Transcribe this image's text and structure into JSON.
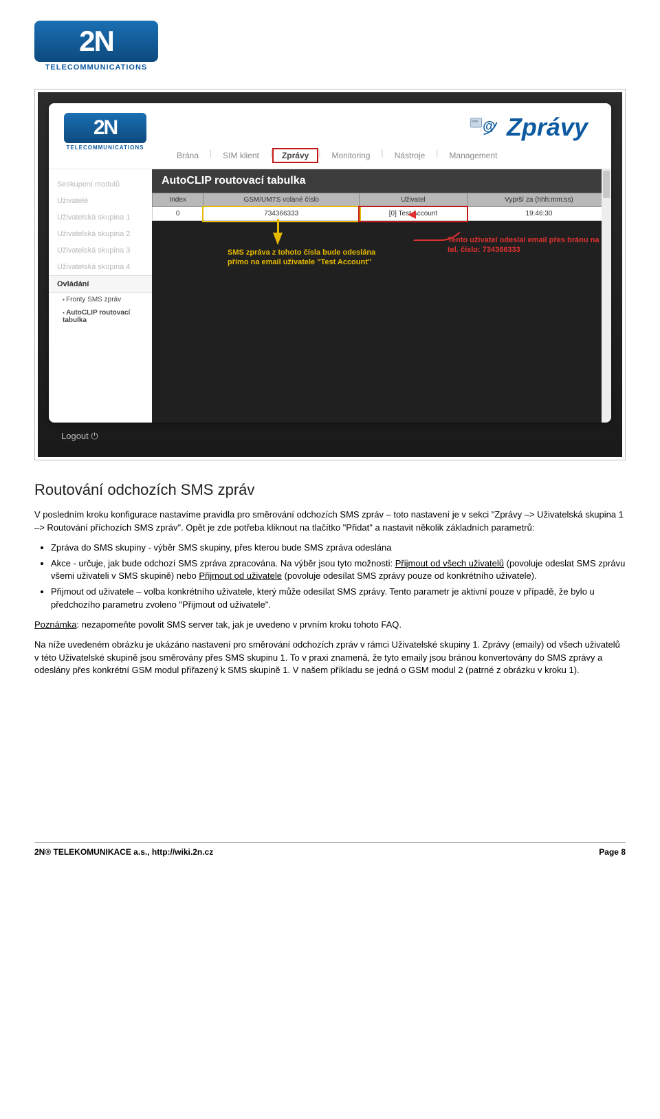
{
  "logo": {
    "text": "2N",
    "caption": "TELECOMMUNICATIONS"
  },
  "screenshot": {
    "header": {
      "title": "Zprávy",
      "nav": [
        "Brána",
        "SIM klient",
        "Zprávy",
        "Monitoring",
        "Nástroje",
        "Management"
      ],
      "active_index": 2
    },
    "sidebar": {
      "items": [
        "Seskupení modulů",
        "Uživatelé",
        "Uživatelská skupina 1",
        "Uživatelská skupina 2",
        "Uživatelská skupina 3",
        "Uživatelská skupina 4"
      ],
      "section": "Ovládání",
      "subitems": [
        "Fronty SMS zpráv",
        "AutoCLIP routovací tabulka"
      ]
    },
    "main": {
      "title": "AutoCLIP routovací tabulka",
      "table": {
        "headers": [
          "Index",
          "GSM/UMTS volané číslo",
          "Uživatel",
          "Vyprší za (hhh:mm:ss)"
        ],
        "row": [
          "0",
          "734366333",
          "[0] Test Account",
          "19:46:30"
        ]
      },
      "annot_yellow": "SMS zpráva z tohoto čísla bude odeslána přímo na email uživatele \"Test Account\"",
      "annot_red": "Tento uživatel odeslal email přes bránu na tel. číslo: 734366333"
    },
    "logout": "Logout"
  },
  "article": {
    "heading": "Routování odchozích SMS zpráv",
    "p1": "V posledním kroku konfigurace nastavíme pravidla pro směrování odchozích SMS zpráv – toto nastavení je v sekci \"Zprávy –> Uživatelská skupina 1 –> Routování příchozích SMS zpráv\". Opět je zde potřeba kliknout na tlačítko \"Přidat\" a nastavit několik základních parametrů:",
    "bullet1": "Zpráva do SMS skupiny - výběr SMS skupiny, přes kterou bude SMS zpráva odeslána",
    "bullet2a": "Akce - určuje, jak bude odchozí SMS zpráva zpracována. Na výběr jsou tyto možnosti: ",
    "bullet2_u1": "Přijmout od všech uživatelů",
    "bullet2b": " (povoluje odeslat SMS zprávu všemi uživateli v SMS skupině) nebo ",
    "bullet2_u2": "Přijmout od uživatele",
    "bullet2c": " (povoluje odesílat SMS zprávy pouze od konkrétního uživatele).",
    "bullet3": "Přijmout od uživatele – volba konkrétního uživatele, který může odesílat SMS zprávy. Tento parametr je aktivní pouze v případě, že bylo u předchozího parametru zvoleno \"Přijmout od uživatele\".",
    "p2_u": "Poznámka",
    "p2": ": nezapomeňte povolit SMS server tak, jak je uvedeno v prvním kroku tohoto FAQ.",
    "p3": "Na níže uvedeném obrázku je ukázáno nastavení pro směrování odchozích zpráv v rámci Uživatelské skupiny 1. Zprávy (emaily) od všech uživatelů v této Uživatelské skupině jsou směrovány přes SMS skupinu 1. To v praxi znamená, že tyto emaily jsou bránou konvertovány do SMS zprávy a odeslány přes konkrétní GSM modul přiřazený k SMS skupině 1. V našem příkladu se jedná o GSM modul 2 (patrné z obrázku v kroku 1)."
  },
  "footer": {
    "left": "2N® TELEKOMUNIKACE a.s., http://wiki.2n.cz",
    "right": "Page 8"
  }
}
